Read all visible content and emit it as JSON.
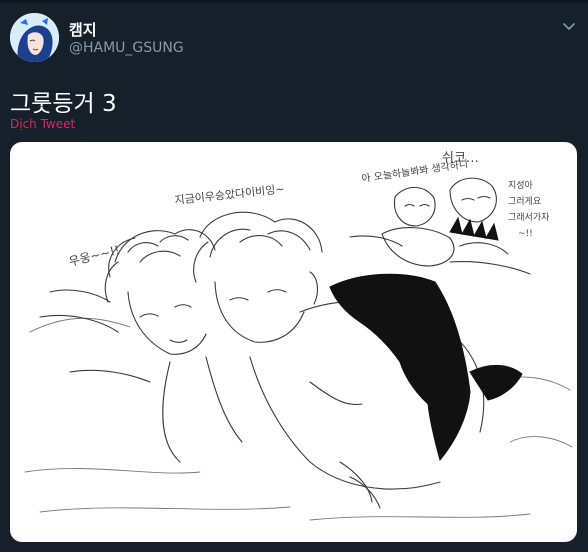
{
  "tweet": {
    "author_name": "캠지",
    "author_handle": "@HAMU_GSUNG",
    "text": "그룻등거 3",
    "translate_label": "Dịch Tweet"
  },
  "media": {
    "handwritten_notes": {
      "left": "우웅~~!!",
      "top": "지금이우승았다이비잉~",
      "right_top": "아 오늘하늘봐봐 생각하니",
      "right_top_extra": "쉬코…",
      "right_side_1": "지성아",
      "right_side_2": "그러게요",
      "right_side_3": "그래서가자",
      "right_side_4": "~!!"
    }
  },
  "colors": {
    "background": "#15202b",
    "name": "#ffffff",
    "handle": "#8899a6",
    "translate": "#e0245e",
    "media_bg": "#ffffff"
  },
  "icons": {
    "menu": "chevron-down-icon"
  }
}
